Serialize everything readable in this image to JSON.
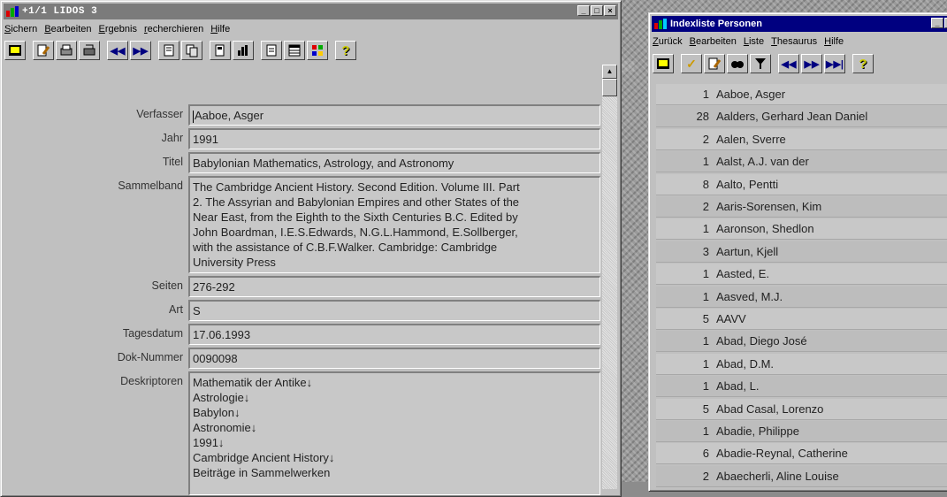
{
  "lidos": {
    "title": "+1/1  LIDOS 3",
    "menu": [
      {
        "label": "Sichern",
        "u": "S"
      },
      {
        "label": "Bearbeiten",
        "u": "B"
      },
      {
        "label": "Ergebnis",
        "u": "E"
      },
      {
        "label": "recherchieren",
        "u": "r"
      },
      {
        "label": "Hilfe",
        "u": "H"
      }
    ],
    "toolbar_icons": [
      "exit-icon",
      "edit-icon",
      "print-icon",
      "print-preview-icon",
      "rewind-icon",
      "forward-icon",
      "list-icon",
      "copy-icon",
      "export-icon",
      "statistics-icon",
      "document-icon",
      "table-icon",
      "color-sort-icon",
      "help-icon"
    ],
    "fields": [
      {
        "label": "Verfasser",
        "value": "Aaboe, Asger"
      },
      {
        "label": "Jahr",
        "value": "1991"
      },
      {
        "label": "Titel",
        "value": "Babylonian Mathematics, Astrology, and Astronomy"
      },
      {
        "label": "Sammelband",
        "lines": [
          "The Cambridge Ancient History. Second Edition. Volume III. Part",
          "2. The Assyrian and Babylonian Empires and other States of the",
          "Near East, from the Eighth to the Sixth Centuries B.C. Edited by",
          "John Boardman, I.E.S.Edwards, N.G.L.Hammond, E.Sollberger,",
          "with the assistance of C.B.F.Walker. Cambridge: Cambridge",
          "University Press"
        ]
      },
      {
        "label": "Seiten",
        "value": "276-292"
      },
      {
        "label": "Art",
        "value": "S"
      },
      {
        "label": "Tagesdatum",
        "value": "17.06.1993"
      },
      {
        "label": "Dok-Nummer",
        "value": "0090098"
      },
      {
        "label": "Deskriptoren",
        "lines": [
          "Mathematik der Antike↓",
          "Astrologie↓",
          "Babylon↓",
          "Astronomie↓",
          "1991↓",
          "Cambridge Ancient History↓",
          "Beiträge in Sammelwerken"
        ]
      }
    ]
  },
  "index": {
    "title": "Indexliste Personen",
    "menu": [
      {
        "label": "Zurück",
        "u": "Z"
      },
      {
        "label": "Bearbeiten",
        "u": "B"
      },
      {
        "label": "Liste",
        "u": "L"
      },
      {
        "label": "Thesaurus",
        "u": "T"
      },
      {
        "label": "Hilfe",
        "u": "H"
      }
    ],
    "toolbar_icons": [
      "exit-icon",
      "check-icon",
      "edit-icon",
      "find-icon",
      "filter-icon",
      "rewind-icon",
      "forward-icon",
      "last-icon",
      "help-icon"
    ],
    "entries": [
      {
        "count": "1",
        "name": "Aaboe, Asger"
      },
      {
        "count": "28",
        "name": "Aalders, Gerhard Jean Daniel"
      },
      {
        "count": "2",
        "name": "Aalen, Sverre"
      },
      {
        "count": "1",
        "name": "Aalst, A.J. van der"
      },
      {
        "count": "8",
        "name": "Aalto, Pentti"
      },
      {
        "count": "2",
        "name": "Aaris-Sorensen, Kim"
      },
      {
        "count": "1",
        "name": "Aaronson, Shedlon"
      },
      {
        "count": "3",
        "name": "Aartun, Kjell"
      },
      {
        "count": "1",
        "name": "Aasted, E."
      },
      {
        "count": "1",
        "name": "Aasved, M.J."
      },
      {
        "count": "5",
        "name": "AAVV"
      },
      {
        "count": "1",
        "name": "Abad, Diego José"
      },
      {
        "count": "1",
        "name": "Abad, D.M."
      },
      {
        "count": "1",
        "name": "Abad, L."
      },
      {
        "count": "5",
        "name": "Abad Casal, Lorenzo"
      },
      {
        "count": "1",
        "name": "Abadie, Philippe"
      },
      {
        "count": "6",
        "name": "Abadie-Reynal, Catherine"
      },
      {
        "count": "2",
        "name": "Abaecherli, Aline Louise"
      }
    ]
  },
  "colors": {
    "inactive_title": "#7b7b7b",
    "active_title": "#000080"
  }
}
